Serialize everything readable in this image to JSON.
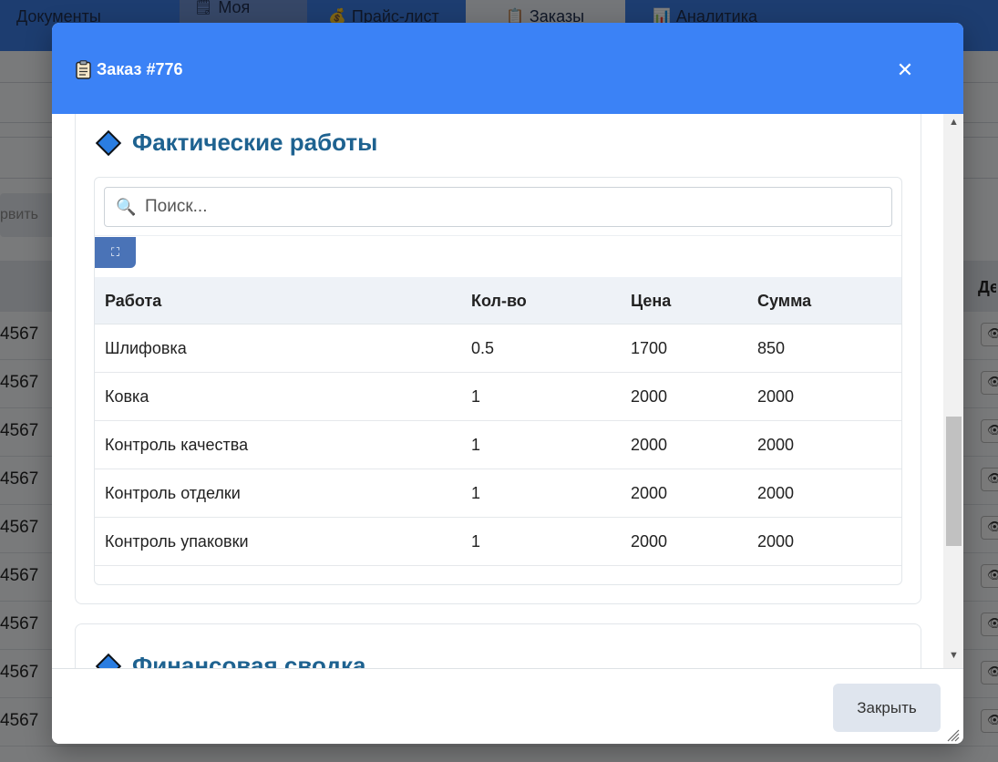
{
  "background": {
    "nav": [
      {
        "icon": "",
        "label": "Документы",
        "active": false
      },
      {
        "icon": "🗒",
        "label": "Моя",
        "active": false
      },
      {
        "icon": "💰",
        "label": "Прайс-лист",
        "active": false
      },
      {
        "icon": "📋",
        "label": "Заказы",
        "active": true
      },
      {
        "icon": "📊",
        "label": "Аналитика",
        "active": false
      }
    ],
    "right_header": "Де",
    "left_button_text": "рвить",
    "row_numbers": [
      "4567",
      "4567",
      "4567",
      "4567",
      "4567",
      "4567",
      "4567",
      "4567",
      "4567"
    ]
  },
  "modal": {
    "title": "Заказ #776",
    "close_symbol": "✕",
    "section_works": {
      "title": "Фактические работы",
      "search_placeholder": "Поиск...",
      "expand_symbol": "⛶",
      "columns": [
        "Работа",
        "Кол-во",
        "Цена",
        "Сумма"
      ],
      "rows": [
        [
          "Шлифовка",
          "0.5",
          "1700",
          "850"
        ],
        [
          "Ковка",
          "1",
          "2000",
          "2000"
        ],
        [
          "Контроль качества",
          "1",
          "2000",
          "2000"
        ],
        [
          "Контроль отделки",
          "1",
          "2000",
          "2000"
        ],
        [
          "Контроль упаковки",
          "1",
          "2000",
          "2000"
        ]
      ]
    },
    "section_finance": {
      "title": "Финансовая сводка"
    },
    "footer": {
      "close_label": "Закрыть"
    }
  }
}
